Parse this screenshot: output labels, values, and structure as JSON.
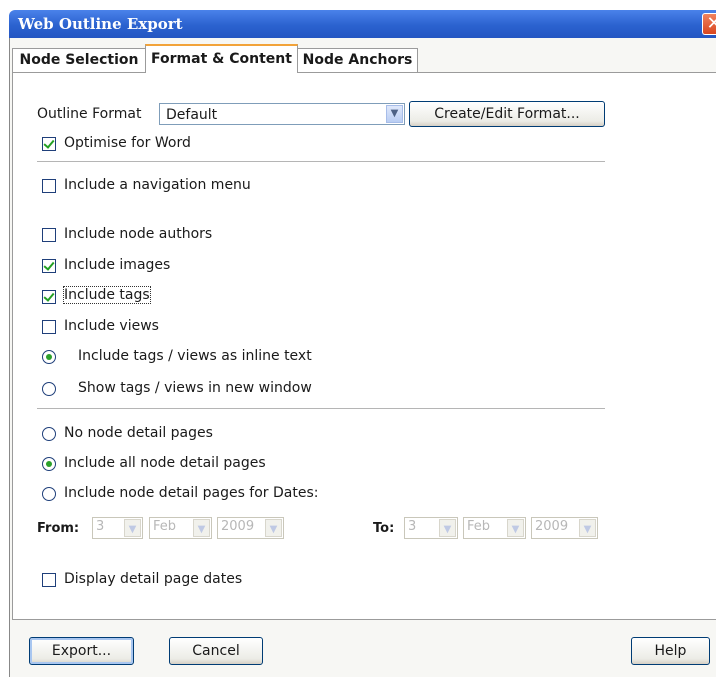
{
  "window": {
    "title": "Web Outline Export",
    "close_glyph": "✕"
  },
  "tabs": [
    {
      "label": "Node Selection"
    },
    {
      "label": "Format & Content"
    },
    {
      "label": "Node Anchors"
    }
  ],
  "active_tab": "Format & Content",
  "format": {
    "outline_format_label": "Outline Format",
    "outline_format_value": "Default",
    "create_edit_label": "Create/Edit Format...",
    "optimise_label": "Optimise for Word",
    "optimise_checked": true
  },
  "options": {
    "nav_menu": {
      "label": "Include a navigation menu",
      "checked": false
    },
    "node_authors": {
      "label": "Include node authors",
      "checked": false
    },
    "images": {
      "label": "Include images",
      "checked": true
    },
    "tags": {
      "label": "Include tags",
      "checked": true
    },
    "views": {
      "label": "Include views",
      "checked": false
    },
    "inline_text": {
      "label": "Include tags / views as inline text",
      "selected": true
    },
    "new_window": {
      "label": "Show tags / views in new window",
      "selected": false
    }
  },
  "detail_pages": {
    "none": {
      "label": "No node detail pages",
      "selected": false
    },
    "all": {
      "label": "Include all node detail pages",
      "selected": true
    },
    "dates": {
      "label": "Include node detail pages for Dates:",
      "selected": false
    },
    "from_label": "From:",
    "to_label": "To:",
    "from": {
      "day": "3",
      "month": "Feb",
      "year": "2009"
    },
    "to": {
      "day": "3",
      "month": "Feb",
      "year": "2009"
    },
    "display_dates": {
      "label": "Display detail page dates",
      "checked": false
    }
  },
  "buttons": {
    "export": "Export...",
    "cancel": "Cancel",
    "help": "Help"
  },
  "colors": {
    "titlebar": "#2b62cf",
    "active_tab_accent": "#f2a33a",
    "check_green": "#23a023"
  },
  "icons": {
    "dropdown": "chevron-down-icon",
    "close": "close-icon"
  }
}
